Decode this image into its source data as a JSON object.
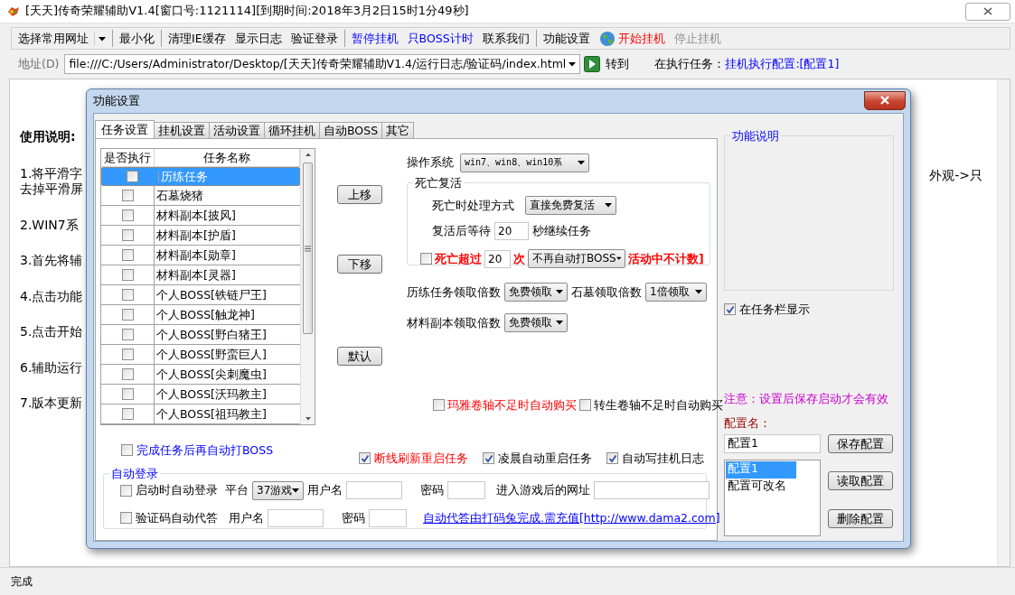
{
  "window": {
    "title": "[天天]传奇荣耀辅助V1.4[窗口号:1121114][到期时间:2018年3月2日15时1分49秒]"
  },
  "toolbar": {
    "groups": [
      [
        {
          "kind": "dropdown",
          "label": "选择常用网址",
          "disabled": false
        }
      ],
      [
        {
          "kind": "button",
          "label": "最小化",
          "disabled": false
        }
      ],
      [
        {
          "kind": "button",
          "label": "清理IE缓存",
          "disabled": false
        },
        {
          "kind": "button",
          "label": "显示日志",
          "disabled": false
        },
        {
          "kind": "button",
          "label": "验证登录",
          "disabled": false
        }
      ],
      [
        {
          "kind": "link",
          "label": "暂停挂机",
          "disabled": false
        },
        {
          "kind": "link",
          "label": "只BOSS计时",
          "disabled": false
        },
        {
          "kind": "button",
          "label": "联系我们",
          "disabled": false
        }
      ],
      [
        {
          "kind": "button",
          "label": "功能设置",
          "disabled": false
        },
        {
          "kind": "icon_button",
          "label": "开始挂机",
          "disabled": false
        },
        {
          "kind": "button",
          "label": "停止挂机",
          "disabled": true
        }
      ]
    ]
  },
  "address": {
    "label": "地址(D)",
    "value": "file:///C:/Users/Administrator/Desktop/[天天]传奇荣耀辅助V1.4/运行日志/验证码/index.html",
    "go_button": "转到",
    "task_label": "在执行任务：",
    "task_value": "挂机执行配置:[配置1]"
  },
  "content": {
    "heading": "使用说明:",
    "paragraphs": [
      [
        "1.将平滑字",
        "去掉平滑屏"
      ],
      [
        "2.WIN7系"
      ],
      [
        "3.首先将辅"
      ],
      [
        "4.点击功能"
      ],
      [
        "5.点击开始"
      ],
      [
        "6.辅助运行"
      ],
      [
        "7.版本更新"
      ]
    ],
    "right_fragment": "外观->只"
  },
  "dialog": {
    "title": "功能设置",
    "tabs": [
      {
        "label": "任务设置",
        "selected": true
      },
      {
        "label": "挂机设置",
        "selected": false
      },
      {
        "label": "活动设置",
        "selected": false
      },
      {
        "label": "循环挂机",
        "selected": false
      },
      {
        "label": "自动BOSS",
        "selected": false
      },
      {
        "label": "其它",
        "selected": false
      }
    ],
    "task_table": {
      "columns": [
        "是否执行",
        "任务名称"
      ],
      "rows": [
        {
          "name": "历练任务",
          "checked": false,
          "selected": true
        },
        {
          "name": "石墓烧猪",
          "checked": false,
          "selected": false
        },
        {
          "name": "材料副本[披风]",
          "checked": false,
          "selected": false
        },
        {
          "name": "材料副本[护盾]",
          "checked": false,
          "selected": false
        },
        {
          "name": "材料副本[勋章]",
          "checked": false,
          "selected": false
        },
        {
          "name": "材料副本[灵器]",
          "checked": false,
          "selected": false
        },
        {
          "name": "个人BOSS[铁链尸王]",
          "checked": false,
          "selected": false
        },
        {
          "name": "个人BOSS[触龙神]",
          "checked": false,
          "selected": false
        },
        {
          "name": "个人BOSS[野白猪王]",
          "checked": false,
          "selected": false
        },
        {
          "name": "个人BOSS[野蛮巨人]",
          "checked": false,
          "selected": false
        },
        {
          "name": "个人BOSS[尖刺魔虫]",
          "checked": false,
          "selected": false
        },
        {
          "name": "个人BOSS[沃玛教主]",
          "checked": false,
          "selected": false
        },
        {
          "name": "个人BOSS[祖玛教主]",
          "checked": false,
          "selected": false
        }
      ]
    },
    "buttons": {
      "up": "上移",
      "down": "下移",
      "default": "默认"
    },
    "os": {
      "label": "操作系统",
      "value": "win7、win8、win10系"
    },
    "revive": {
      "legend": "死亡复活",
      "mode_label": "死亡时处理方式",
      "mode_value": "直接免费复活",
      "wait_label": "复活后等待",
      "wait_value": "20",
      "wait_suffix": "秒继续任务",
      "limit_checked": false,
      "limit_label": "死亡超过",
      "limit_value": "20",
      "limit_unit": "次",
      "limit_action": "不再自动打BOSS",
      "limit_note": "活动中不计数]"
    },
    "multipliers": [
      {
        "label": "历练任务领取倍数",
        "value": "免费领取"
      },
      {
        "label": "石墓领取倍数",
        "value": "1倍领取"
      },
      {
        "label": "材料副本领取倍数",
        "value": "免费领取"
      }
    ],
    "purchase_options": [
      {
        "label": "玛雅卷轴不足时自动购买",
        "checked": false,
        "emphasized": true
      },
      {
        "label": "转生卷轴不足时自动购买",
        "checked": false,
        "emphasized": false
      }
    ],
    "boss_after_tasks": {
      "label": "完成任务后再自动打BOSS",
      "checked": false
    },
    "restart_options": [
      {
        "label": "断线刷新重启任务",
        "checked": true,
        "emphasized": true
      },
      {
        "label": "凌晨自动重启任务",
        "checked": true,
        "emphasized": false
      },
      {
        "label": "自动写挂机日志",
        "checked": true,
        "emphasized": false
      }
    ],
    "auto_login": {
      "legend": "自动登录",
      "startup": {
        "label": "启动时自动登录",
        "checked": false,
        "platform_label": "平台",
        "platform": "37游戏",
        "user_label": "用户名",
        "password_label": "密码",
        "url_label": "进入游戏后的网址"
      },
      "captcha": {
        "label": "验证码自动代答",
        "checked": false,
        "user_label": "用户名",
        "password_label": "密码",
        "link": "自动代答由打码兔完成.需充值[http://www.dama2.com]"
      }
    },
    "side": {
      "help_legend": "功能说明",
      "taskbar": {
        "label": "在任务栏显示",
        "checked": true
      },
      "notice": "注意：设置后保存启动才会有效",
      "config_label": "配置名：",
      "config_name": "配置1",
      "save_button": "保存配置",
      "load_button": "读取配置",
      "delete_button": "删除配置",
      "configs": [
        {
          "name": "配置1",
          "selected": true
        },
        {
          "name": "配置可改名",
          "selected": false
        }
      ]
    }
  },
  "status_bar": "完成"
}
